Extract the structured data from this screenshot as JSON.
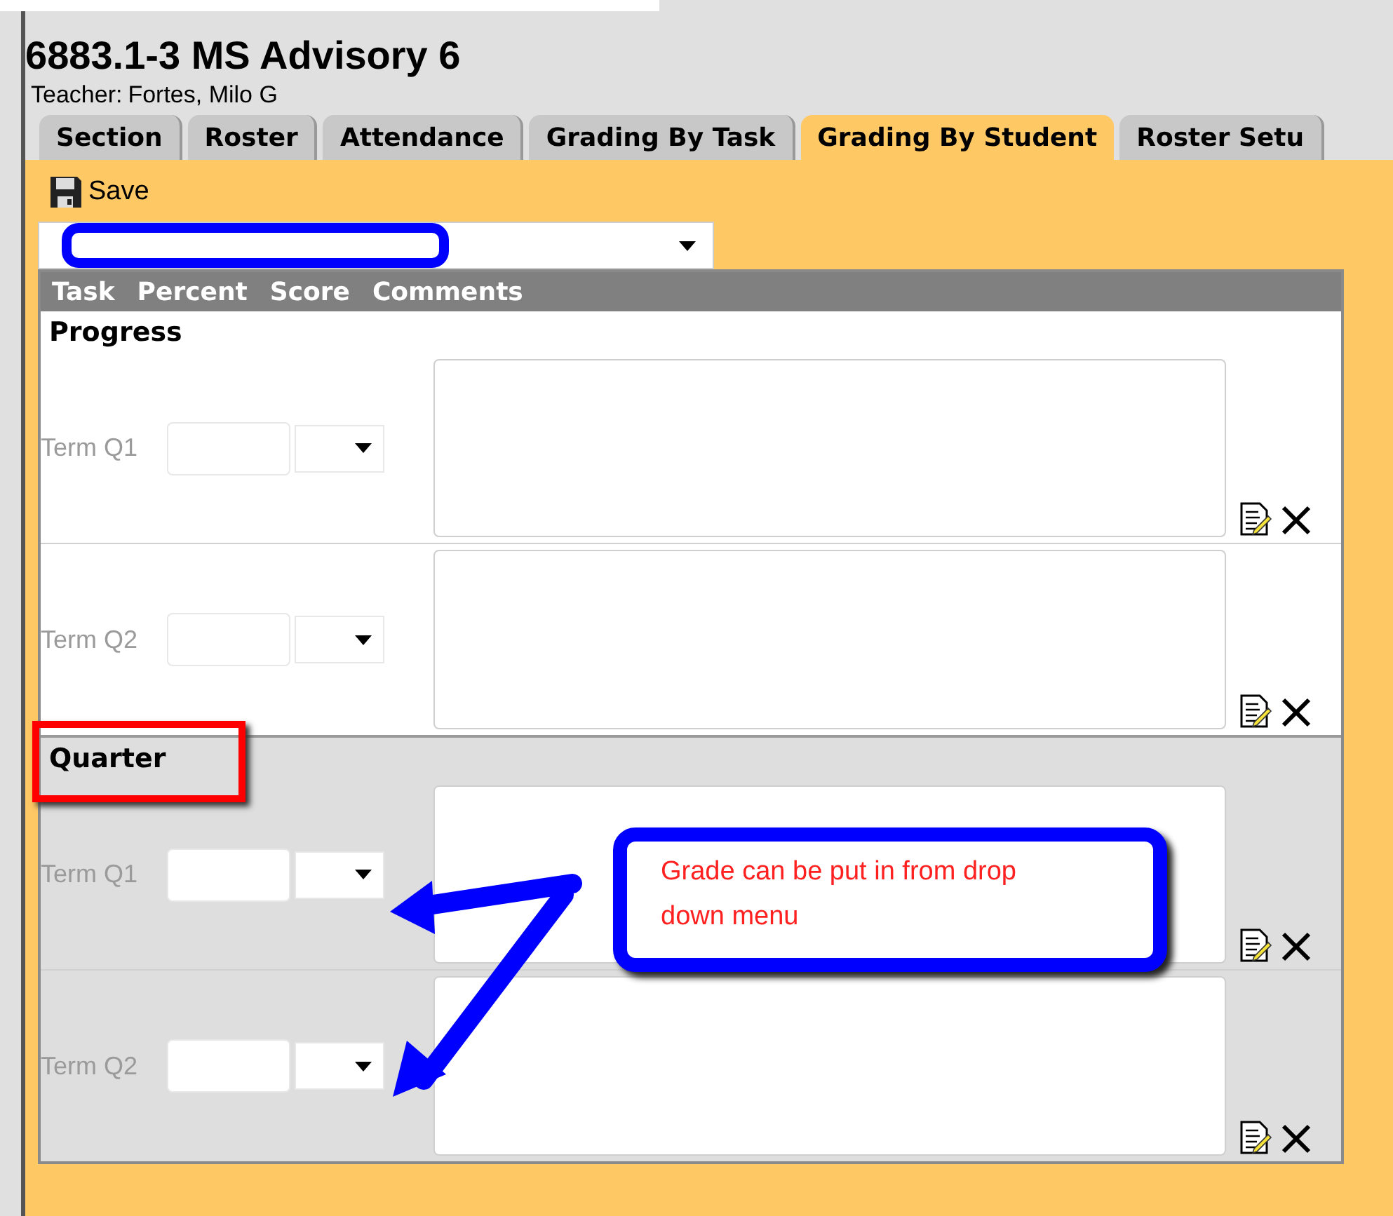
{
  "title": "6883.1-3 MS Advisory 6",
  "teacher": {
    "label": "Teacher:",
    "name": "Fortes, Milo G"
  },
  "tabs": [
    {
      "label": "Section",
      "selected": false
    },
    {
      "label": "Roster",
      "selected": false
    },
    {
      "label": "Attendance",
      "selected": false
    },
    {
      "label": "Grading By Task",
      "selected": false
    },
    {
      "label": "Grading By Student",
      "selected": true
    },
    {
      "label": "Roster Setu",
      "selected": false
    }
  ],
  "toolbar": {
    "save": "Save"
  },
  "table": {
    "columns": [
      "Task",
      "Percent",
      "Score",
      "Comments"
    ],
    "sections": [
      {
        "name": "Progress",
        "highlighted": false,
        "rows": [
          {
            "term": "Term Q1"
          },
          {
            "term": "Term Q2"
          }
        ]
      },
      {
        "name": "Quarter",
        "highlighted": true,
        "rows": [
          {
            "term": "Term Q1"
          },
          {
            "term": "Term Q2"
          }
        ]
      }
    ]
  },
  "callout": {
    "text": "Grade can be put in from drop down menu"
  }
}
